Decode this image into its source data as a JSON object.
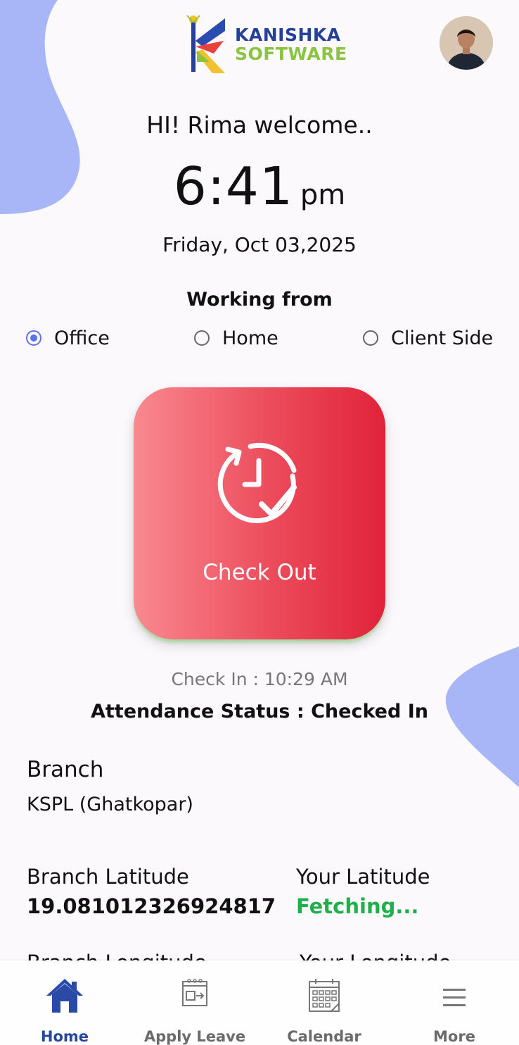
{
  "header": {
    "logo_line1": "KANISHKA",
    "logo_line2": "SOFTWARE",
    "avatar_icon": "user-avatar"
  },
  "greeting": "HI! Rima welcome..",
  "clock": {
    "time": "6:41",
    "ampm": "pm"
  },
  "date": "Friday, Oct 03,2025",
  "working_from": {
    "label": "Working from",
    "options": [
      "Office",
      "Home",
      "Client Side"
    ],
    "selected": "Office"
  },
  "action": {
    "label": "Check Out",
    "icon": "clock-check-icon"
  },
  "check_in": "Check In : 10:29 AM",
  "attendance_status": "Attendance Status : Checked In",
  "branch": {
    "label": "Branch",
    "value": "KSPL (Ghatkopar)"
  },
  "location": {
    "branch_latitude_label": "Branch Latitude",
    "branch_latitude_value": "19.081012326924817",
    "your_latitude_label": "Your Latitude",
    "your_latitude_value": "Fetching...",
    "branch_longitude_label": "Branch Longitude",
    "your_longitude_label": "Your Longitude"
  },
  "nav": {
    "items": [
      {
        "label": "Home",
        "icon": "home-icon",
        "active": true
      },
      {
        "label": "Apply Leave",
        "icon": "leave-icon",
        "active": false
      },
      {
        "label": "Calendar",
        "icon": "calendar-icon",
        "active": false
      },
      {
        "label": "More",
        "icon": "menu-icon",
        "active": false
      }
    ]
  },
  "colors": {
    "accent": "#5b74e6",
    "blob": "#a8b6f8",
    "button_start": "#f98990",
    "button_end": "#e0233a",
    "fetching": "#1fb04b",
    "nav_active": "#26479e"
  }
}
